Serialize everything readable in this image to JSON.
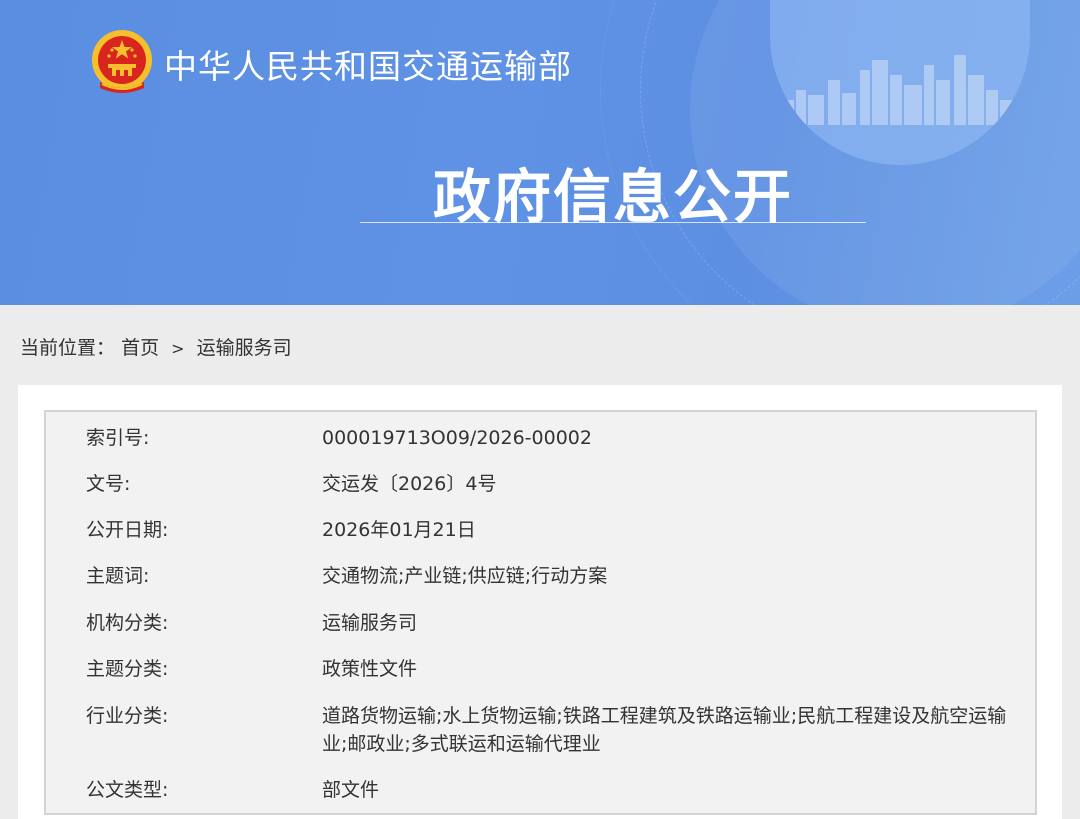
{
  "header": {
    "ministry_name": "中华人民共和国交通运输部",
    "title": "政府信息公开",
    "emblem_icon": "national-emblem-icon",
    "colors": {
      "banner": "#5f92e4",
      "text": "#ffffff"
    }
  },
  "breadcrumb": {
    "prefix": "当前位置：",
    "items": [
      "首页",
      "运输服务司"
    ],
    "separator": ">"
  },
  "info": {
    "rows": [
      {
        "label": "索引号:",
        "value": "000019713O09/2026-00002"
      },
      {
        "label": "文号:",
        "value": "交运发〔2026〕4号"
      },
      {
        "label": "公开日期:",
        "value": "2026年01月21日"
      },
      {
        "label": "主题词:",
        "value": "交通物流;产业链;供应链;行动方案"
      },
      {
        "label": "机构分类:",
        "value": "运输服务司"
      },
      {
        "label": "主题分类:",
        "value": "政策性文件"
      },
      {
        "label": "行业分类:",
        "value": "道路货物运输;水上货物运输;铁路工程建筑及铁路运输业;民航工程建设及航空运输业;邮政业;多式联运和运输代理业"
      },
      {
        "label": "公文类型:",
        "value": "部文件"
      }
    ]
  }
}
